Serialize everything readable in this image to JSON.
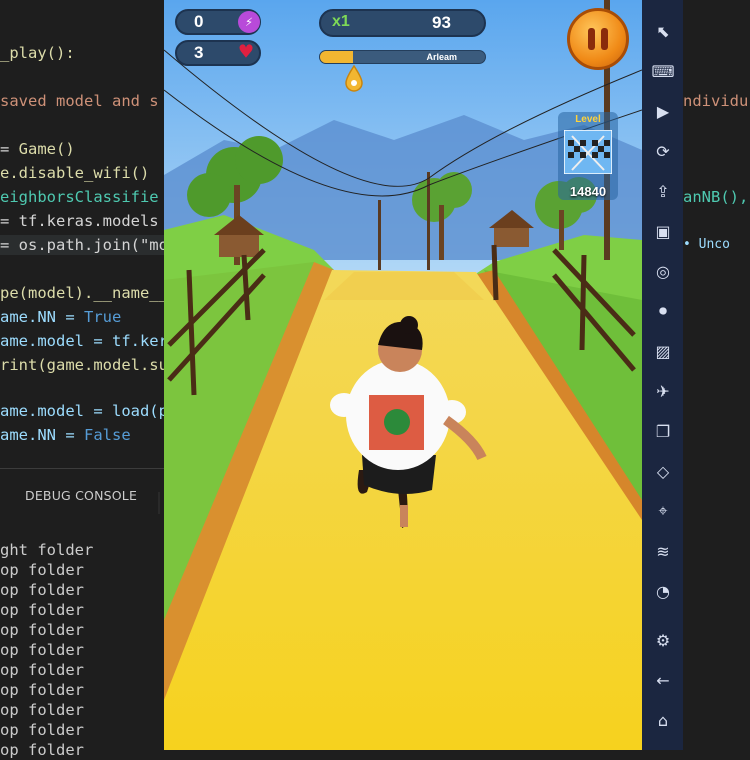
{
  "editor": {
    "lines": [
      {
        "parts": [
          {
            "t": "_play():",
            "c": "t-fn"
          }
        ]
      },
      {
        "parts": [
          {
            "t": "saved model and s",
            "c": "t-cm"
          }
        ]
      },
      {
        "parts": [
          {
            "t": "= ",
            "c": ""
          },
          {
            "t": "Game()",
            "c": "t-fn"
          }
        ]
      },
      {
        "parts": [
          {
            "t": "e.disable_wifi()",
            "c": "t-fn"
          }
        ]
      },
      {
        "parts": [
          {
            "t": "eighborsClassifie",
            "c": "t-cls"
          }
        ]
      },
      {
        "parts": [
          {
            "t": "= tf.keras.models",
            "c": ""
          }
        ]
      },
      {
        "parts": [
          {
            "t": "= os.path.join(\"mo",
            "c": ""
          }
        ]
      },
      {
        "parts": [
          {
            "t": "pe(model).__name__",
            "c": "t-fn"
          }
        ]
      },
      {
        "parts": [
          {
            "t": "ame.NN = ",
            "c": "t-var"
          },
          {
            "t": "True",
            "c": "t-kw"
          }
        ]
      },
      {
        "parts": [
          {
            "t": "ame.model = tf.ker",
            "c": "t-var"
          }
        ]
      },
      {
        "parts": [
          {
            "t": "rint(game.model.su",
            "c": "t-fn"
          }
        ]
      },
      {
        "parts": [
          {
            "t": "ame.model = load(p",
            "c": "t-var"
          }
        ]
      },
      {
        "parts": [
          {
            "t": "ame.NN = ",
            "c": "t-var"
          },
          {
            "t": "False",
            "c": "t-kw"
          }
        ]
      }
    ],
    "right_lines": [
      {
        "text": "ndividu",
        "c": "t-cm"
      },
      {
        "text": "anNB(),",
        "c": "t-cls"
      },
      {
        "text": "• Unco",
        "c": "t-var"
      }
    ]
  },
  "panel": {
    "tab_label": "DEBUG CONSOLE",
    "output": [
      "ght folder",
      "op folder",
      "op folder",
      "op folder",
      "op folder",
      "op folder",
      "op folder",
      "op folder",
      "op folder",
      "op folder",
      "op folder"
    ]
  },
  "game": {
    "coins": "0",
    "lives": "3",
    "multiplier": "x1",
    "score": "93",
    "progress_label": "Arleam",
    "progress_value": 0.2,
    "level_label": "Level",
    "level_score": "14840"
  },
  "colors": {
    "sky": "#7db8f0",
    "road": "#f4d23a",
    "grass": "#6cc33b",
    "hud": "#2d4a6b",
    "pause": "#f08a17",
    "sidebar": "#1b2640"
  },
  "sidebar": {
    "icons": [
      "cursor-icon",
      "keyboard-icon",
      "record-icon",
      "sync-icon",
      "apk-install-icon",
      "apk-icon",
      "screenshot-icon",
      "screen-record-icon",
      "gallery-icon",
      "airplane-mode-icon",
      "multi-window-icon",
      "eraser-icon",
      "location-icon",
      "layers-icon",
      "performance-icon",
      "settings-icon",
      "back-icon",
      "home-icon"
    ]
  }
}
